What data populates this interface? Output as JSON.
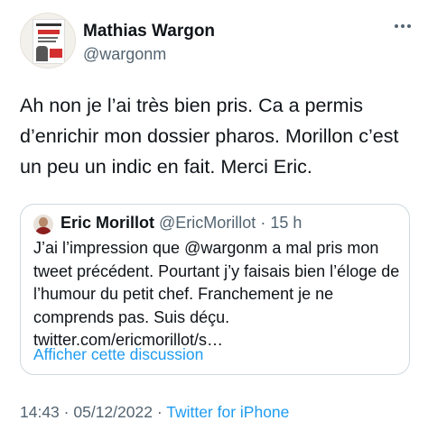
{
  "author": {
    "name": "Mathias Wargon",
    "handle": "@wargonm"
  },
  "tweet": {
    "text": "Ah non je l’ai très bien pris. Ca a permis d’enrichir mon dossier pharos. Morillon c’est un peu un indic en fait. Merci Eric."
  },
  "quoted_tweet": {
    "name": "Eric Morillot",
    "handle": "@EricMorillot",
    "separator": "·",
    "age": "15 h",
    "text": "J’ai l’impression que @wargonm a mal pris mon tweet précédent. Pourtant j’y faisais bien l’éloge de l’humour du petit chef. Franchement je ne comprends pas. Suis déçu. twitter.com/ericmorillot/s…",
    "action": "Afficher cette discussion"
  },
  "footer": {
    "time": "14:43",
    "separator": "·",
    "date": "05/12/2022",
    "source": "Twitter for iPhone"
  },
  "colors": {
    "link": "#1d9bf0",
    "secondary_text": "#536471",
    "border": "#cfd9de"
  }
}
